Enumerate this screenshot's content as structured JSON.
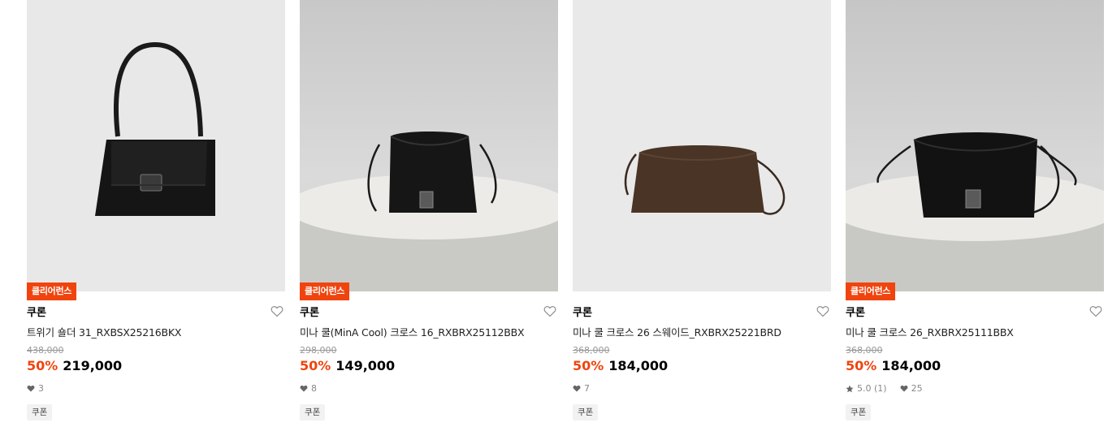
{
  "products": [
    {
      "badge": "클리어런스",
      "brand": "쿠론",
      "name": "트위기 숄더 31_RXBSX25216BKX",
      "original_price": "438,000",
      "discount": "50%",
      "price": "219,000",
      "likes": "3",
      "rating": "",
      "coupon": "쿠폰"
    },
    {
      "badge": "클리어런스",
      "brand": "쿠론",
      "name": "미나 쿨(MinA Cool) 크로스 16_RXBRX25112BBX",
      "original_price": "298,000",
      "discount": "50%",
      "price": "149,000",
      "likes": "8",
      "rating": "",
      "coupon": "쿠폰"
    },
    {
      "badge": "",
      "brand": "쿠론",
      "name": "미나 쿨 크로스 26 스웨이드_RXBRX25221BRD",
      "original_price": "368,000",
      "discount": "50%",
      "price": "184,000",
      "likes": "7",
      "rating": "",
      "coupon": "쿠폰"
    },
    {
      "badge": "클리어런스",
      "brand": "쿠론",
      "name": "미나 쿨 크로스 26_RXBRX25111BBX",
      "original_price": "368,000",
      "discount": "50%",
      "price": "184,000",
      "likes": "25",
      "rating": "5.0 (1)",
      "coupon": "쿠폰"
    }
  ],
  "colors": {
    "accent": "#f0440e",
    "strike": "#999999",
    "coupon_bg": "#f2f2f2"
  },
  "icons": [
    "heart-outline-icon",
    "heart-filled-icon",
    "star-icon"
  ]
}
